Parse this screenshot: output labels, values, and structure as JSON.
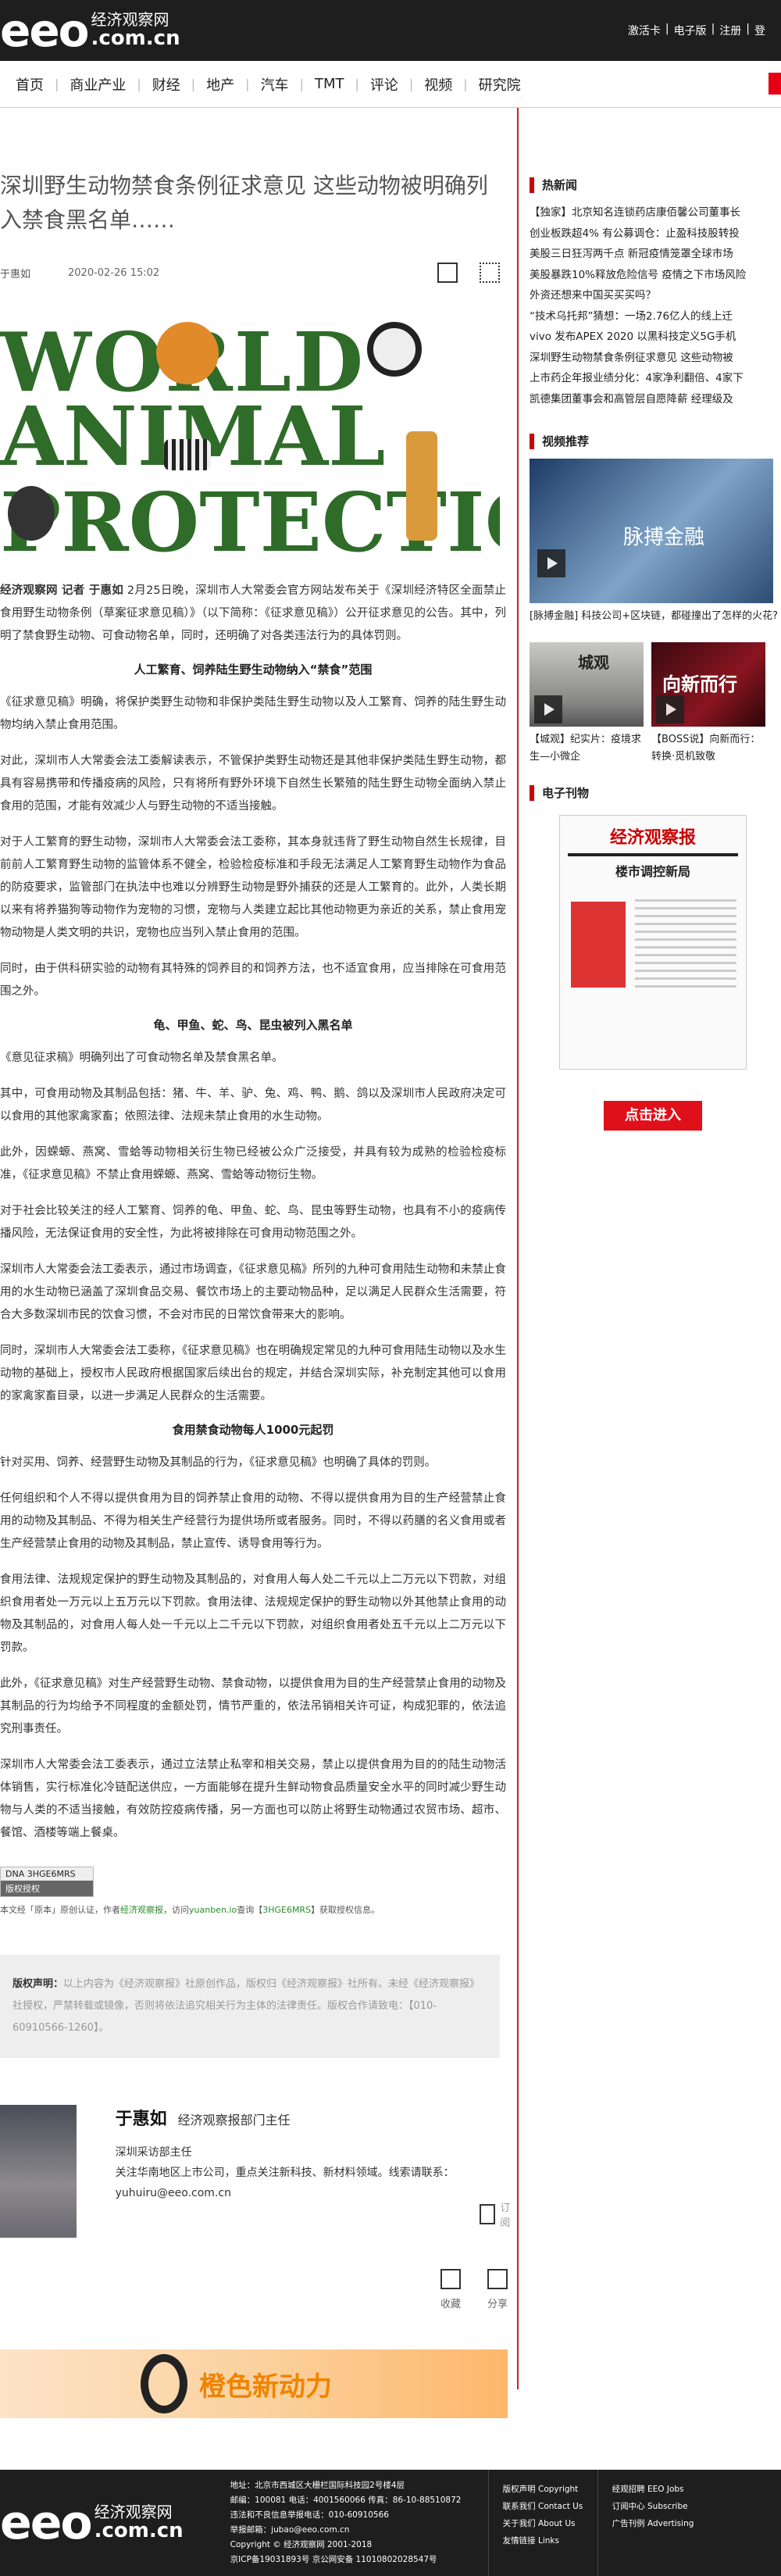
{
  "header": {
    "logo_main": "eeo",
    "logo_cn": "经济观察网",
    "logo_com": ".com.cn",
    "links": [
      "激活卡",
      "电子版",
      "注册",
      "登"
    ]
  },
  "nav": [
    "首页",
    "商业产业",
    "财经",
    "地产",
    "汽车",
    "TMT",
    "评论",
    "视频",
    "研究院"
  ],
  "article": {
    "title": "深圳野生动物禁食条例征求意见 这些动物被明确列入禁食黑名单……",
    "author": "于惠如",
    "date": "2020-02-26 15:02",
    "hero_words": [
      "WORLD",
      "ANIMAL",
      "PROTECTION"
    ],
    "lead_source": "经济观察网  记者  于惠如",
    "lead_rest": "  2月25日晚，深圳市人大常委会官方网站发布关于《深圳经济特区全面禁止食用野生动物条例（草案征求意见稿）》（以下简称：《征求意见稿》）公开征求意见的公告。其中，列明了禁食野生动物、可食动物名单，同时，还明确了对各类违法行为的具体罚则。",
    "h1": "人工繁育、饲养陆生野生动物纳入“禁食”范围",
    "p1": "《征求意见稿》明确，将保护类野生动物和非保护类陆生野生动物以及人工繁育、饲养的陆生野生动物均纳入禁止食用范围。",
    "p2": "对此，深圳市人大常委会法工委解读表示，不管保护类野生动物还是其他非保护类陆生野生动物，都具有容易携带和传播疫病的风险，只有将所有野外环境下自然生长繁殖的陆生野生动物全面纳入禁止食用的范围，才能有效减少人与野生动物的不适当接触。",
    "p3": "对于人工繁育的野生动物，深圳市人大常委会法工委称，其本身就违背了野生动物自然生长规律，目前前人工繁育野生动物的监管体系不健全，检验检疫标准和手段无法满足人工繁育野生动物作为食品的防疫要求，监管部门在执法中也难以分辨野生动物是野外捕获的还是人工繁育的。此外，人类长期以来有将养猫狗等动物作为宠物的习惯，宠物与人类建立起比其他动物更为亲近的关系，禁止食用宠物动物是人类文明的共识，宠物也应当列入禁止食用的范围。",
    "p4": "同时，由于供科研实验的动物有其特殊的饲养目的和饲养方法，也不适宜食用，应当排除在可食用范围之外。",
    "h2": "龟、甲鱼、蛇、鸟、昆虫被列入黑名单",
    "p5": "《意见征求稿》明确列出了可食动物名单及禁食黑名单。",
    "p6": "其中，可食用动物及其制品包括：猪、牛、羊、驴、兔、鸡、鸭、鹅、鸽以及深圳市人民政府决定可以食用的其他家禽家畜；依照法律、法规未禁止食用的水生动物。",
    "p7": "此外，因蝾螈、燕窝、雪蛤等动物相关衍生物已经被公众广泛接受，并具有较为成熟的检验检疫标准，《征求意见稿》不禁止食用蝾螈、燕窝、雪蛤等动物衍生物。",
    "p8": "对于社会比较关注的经人工繁育、饲养的龟、甲鱼、蛇、鸟、昆虫等野生动物，也具有不小的疫病传播风险，无法保证食用的安全性，为此将被排除在可食用动物范围之外。",
    "p9": "深圳市人大常委会法工委表示，通过市场调查，《征求意见稿》所列的九种可食用陆生动物和未禁止食用的水生动物已涵盖了深圳食品交易、餐饮市场上的主要动物品种，足以满足人民群众生活需要，符合大多数深圳市民的饮食习惯，不会对市民的日常饮食带来大的影响。",
    "p10": "同时，深圳市人大常委会法工委称，《征求意见稿》也在明确规定常见的九种可食用陆生动物以及水生动物的基础上，授权市人民政府根据国家后续出台的规定，并结合深圳实际，补充制定其他可以食用的家禽家畜目录，以进一步满足人民群众的生活需要。",
    "h3": "食用禁食动物每人1000元起罚",
    "p11": "针对买用、饲养、经营野生动物及其制品的行为，《征求意见稿》也明确了具体的罚则。",
    "p12": "任何组织和个人不得以提供食用为目的饲养禁止食用的动物、不得以提供食用为目的生产经营禁止食用的动物及其制品、不得为相关生产经营行为提供场所或者服务。同时，不得以药膳的名义食用或者生产经营禁止食用的动物及其制品，禁止宣传、诱导食用等行为。",
    "p13": "食用法律、法规规定保护的野生动物及其制品的，对食用人每人处二千元以上二万元以下罚款，对组织食用者处一万元以上五万元以下罚款。食用法律、法规规定保护的野生动物以外其他禁止食用的动物及其制品的，对食用人每人处一千元以上二千元以下罚款，对组织食用者处五千元以上二万元以下罚款。",
    "p14": "此外，《征求意见稿》对生产经营野生动物、禁食动物，以提供食用为目的生产经营禁止食用的动物及其制品的行为均给予不同程度的金额处罚，情节严重的，依法吊销相关许可证，构成犯罪的，依法追究刑事责任。",
    "p15": "深圳市人大常委会法工委表示，通过立法禁止私宰和相关交易，禁止以提供食用为目的的陆生动物活体销售，实行标准化冷链配送供应，一方面能够在提升生鲜动物食品质量安全水平的同时减少野生动物与人类的不适当接触，有效防控疫病传播，另一方面也可以防止将野生动物通过农贸市场、超市、餐馆、酒楼等端上餐桌。",
    "dna_code": "DNA 3HGE6MRS",
    "dna_label": "版权授权",
    "auth_note_pre": "本文经「原本」原创认证，作者",
    "auth_note_org": "经济观察报",
    "auth_note_mid": "，访问",
    "auth_note_site": "yuanben.io",
    "auth_note_mid2": "查询【",
    "auth_note_code": "3HGE6MRS",
    "auth_note_end": "】获取授权信息。"
  },
  "copyright": {
    "label": "版权声明：",
    "text": "以上内容为《经济观察报》社原创作品，版权归《经济观察报》社所有。未经《经济观察报》社授权，严禁转载或镜像，否则将依法追究相关行为主体的法律责任。版权合作请致电：【010-60910566-1260】。"
  },
  "author_box": {
    "name": "于惠如",
    "title": "经济观察报部门主任",
    "role": "深圳采访部主任",
    "desc": "关注华南地区上市公司，重点关注新科技、新材料领域。线索请联系：yuhuiru@eeo.com.cn",
    "subscribe": "订阅"
  },
  "actions": [
    "收藏",
    "分享"
  ],
  "banner_text": "橙色新动力",
  "sidebar": {
    "hot_title": "热新闻",
    "hot_items": [
      "【独家】北京知名连锁药店康佰馨公司董事长",
      "创业板跌超4% 有公募调仓：止盈科技股转投",
      "美股三日狂泻两千点 新冠疫情笼罩全球市场",
      "美股暴跌10%释放危险信号 疫情之下市场风险",
      "外资还想来中国买买买吗？",
      "“技术乌托邦”猜想：一场2.76亿人的线上迁",
      "vivo 发布APEX 2020 以黑科技定义5G手机",
      "深圳野生动物禁食条例征求意见 这些动物被",
      "上市药企年报业绩分化：4家净利翻倍、4家下",
      "凯德集团董事会和高管层自愿降薪 经理级及"
    ],
    "video_title": "视频推荐",
    "video_big_text": "脉搏金融",
    "video_big_caption": "[脉搏金融] 科技公司+区块链，都碰撞出了怎样的火花?",
    "video_small": [
      {
        "caption": "【城观】纪实片：疫境求生—小微企",
        "overlay": "城观"
      },
      {
        "caption": "【BOSS说】向新而行：转换·觅机致敬",
        "overlay": "向新而行"
      }
    ],
    "epaper_title": "电子刊物",
    "epaper_head": "经济观察报",
    "epaper_sub": "楼市调控新局",
    "enter_button": "点击进入"
  },
  "footer": {
    "logo_main": "eeo",
    "logo_cn": "经济观察网",
    "logo_com": ".com.cn",
    "info": [
      "地址：北京市西城区大栅栏国际科技园2号楼4层",
      "邮编：100081 电话：4001560066 传真：86-10-88510872",
      "违法和不良信息举报电话：010-60910566",
      "举报邮箱：jubao@eeo.com.cn",
      "Copyright © 经济观察网 2001-2018",
      "京ICP备19031893号  京公网安备 11010802028547号"
    ],
    "col1": [
      "版权声明 Copyright",
      "联系我们 Contact Us",
      "关于我们 About Us",
      "友情链接 Links"
    ],
    "col2": [
      "经观招聘 EEO Jobs",
      "订阅中心 Subscribe",
      "广告刊例 Advertising"
    ]
  }
}
